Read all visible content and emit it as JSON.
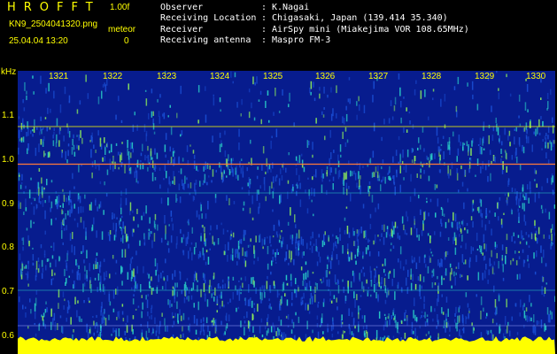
{
  "header": {
    "app_title": "HROFFT",
    "version": "1.00f",
    "filename": "KN9_2504041320.png",
    "meteor_label": "meteor",
    "meteor_count": "0",
    "datetime": "25.04.04 13:20"
  },
  "info": [
    {
      "key": "Observer",
      "value": "K.Nagai"
    },
    {
      "key": "Receiving Location",
      "value": "Chigasaki, Japan (139.414 35.340)"
    },
    {
      "key": "Receiver",
      "value": "AirSpy mini (Miakejima VOR 108.65MHz)"
    },
    {
      "key": "Receiving antenna",
      "value": "Maspro FM-3"
    }
  ],
  "spectrogram": {
    "y_unit": "kHz",
    "y_ticks": [
      "1.1",
      "1.0",
      "0.9",
      "0.8",
      "0.7",
      "0.6"
    ],
    "x_ticks": [
      "1321",
      "1322",
      "1323",
      "1324",
      "1325",
      "1326",
      "1327",
      "1328",
      "1329",
      "1330"
    ],
    "colors": {
      "background": "#071c8e",
      "noise_low": "#1a4fd6",
      "noise_high": "#2ad1c8",
      "strong": "#8ff05a",
      "floor": "#ffff00",
      "line": "#ff7a3a"
    }
  }
}
